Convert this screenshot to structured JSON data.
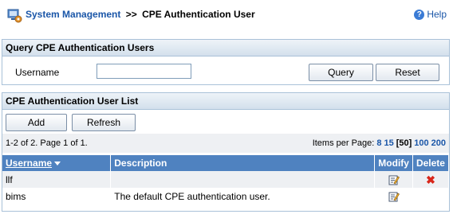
{
  "header": {
    "crumb_parent": "System Management",
    "crumb_sep": ">>",
    "crumb_current": "CPE Authentication User",
    "help_label": "Help"
  },
  "query": {
    "title": "Query CPE Authentication Users",
    "username_label": "Username",
    "username_value": "",
    "query_label": "Query",
    "reset_label": "Reset"
  },
  "list": {
    "title": "CPE Authentication User List",
    "add_label": "Add",
    "refresh_label": "Refresh",
    "summary": "1-2 of 2. Page 1 of 1.",
    "items_per_page_label": "Items per Page:",
    "page_sizes": [
      "8",
      "15",
      "[50]",
      "100",
      "200"
    ],
    "columns": {
      "username": "Username",
      "description": "Description",
      "modify": "Modify",
      "delete": "Delete"
    },
    "rows": [
      {
        "username": "llf",
        "description": ""
      },
      {
        "username": "bims",
        "description": "The default CPE authentication user."
      }
    ]
  },
  "colors": {
    "accent": "#1a56a8",
    "table_header": "#4f82c0",
    "delete": "#d8261a"
  }
}
